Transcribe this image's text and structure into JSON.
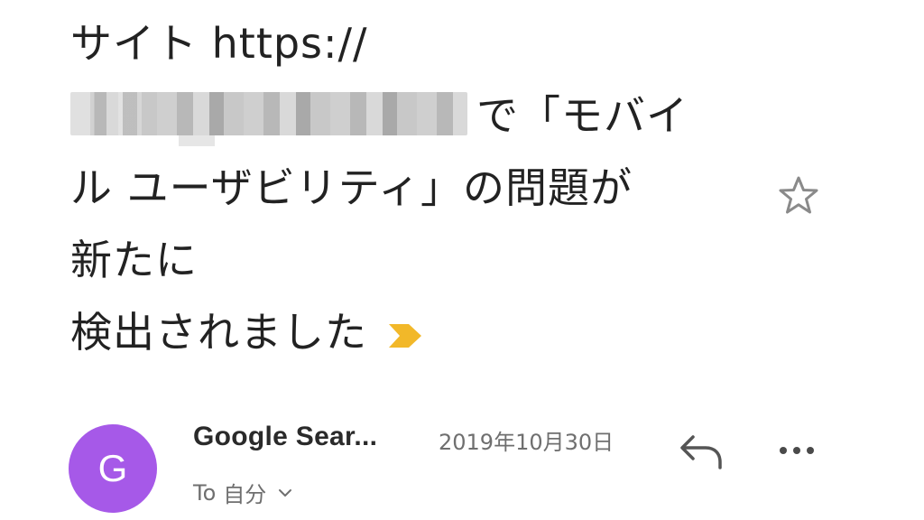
{
  "subject": {
    "line1": "サイト https://",
    "line2_suffix": "で「モバイ",
    "line3": "ル ユーザビリティ」の問題が",
    "line4": "新たに",
    "line5": "検出されました",
    "redacted_domain": "",
    "important_marker_icon": "important-arrow-icon",
    "important_marker_color": "#f2b829"
  },
  "star": {
    "icon": "star-outline-icon",
    "color": "#8a8a8a"
  },
  "message": {
    "avatar_letter": "G",
    "avatar_color": "#a659e8",
    "sender": "Google Sear...",
    "date": "2019年10月30日",
    "to_label": "To",
    "recipient": "自分",
    "recipient_dropdown_icon": "chevron-down-icon",
    "reply_icon": "reply-icon",
    "more_icon": "more-horizontal-icon"
  }
}
